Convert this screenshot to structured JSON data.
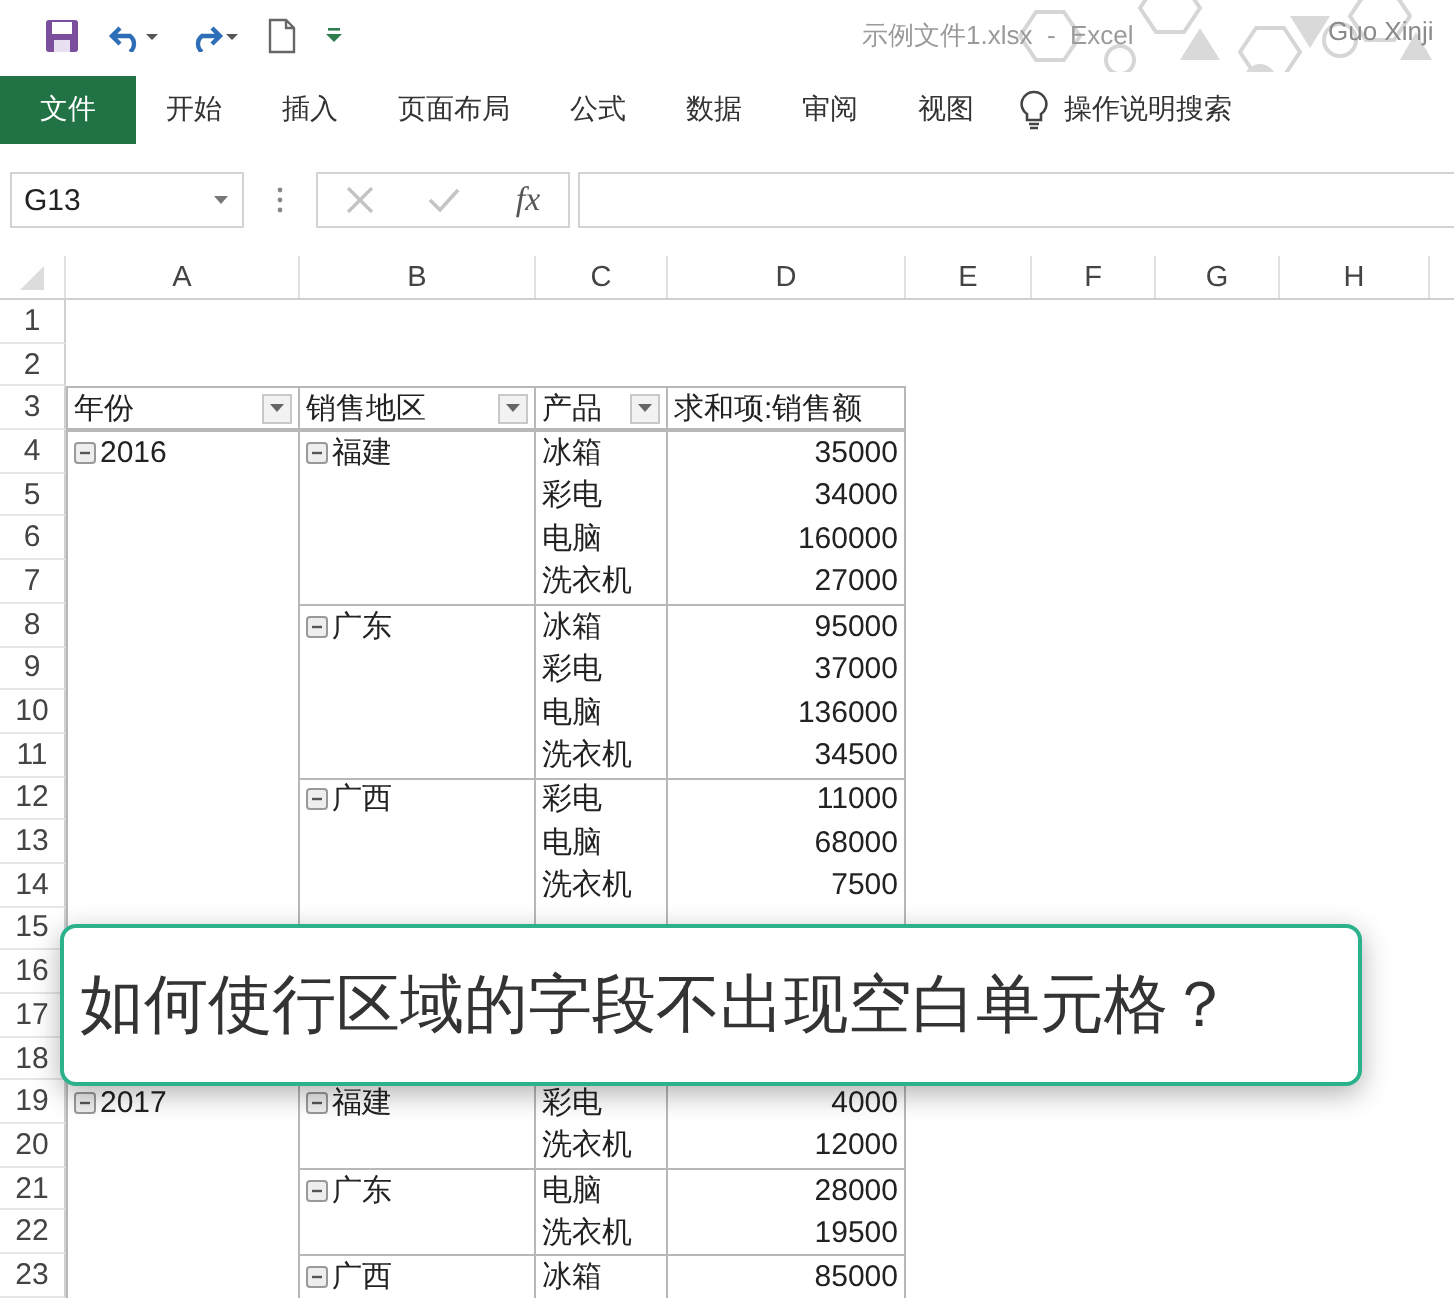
{
  "title_bar": {
    "file_title": "示例文件1.xlsx  -  Excel",
    "user": "Guo Xinji"
  },
  "ribbon": {
    "tabs": [
      {
        "label": "文件",
        "selected": true
      },
      {
        "label": "开始",
        "selected": false
      },
      {
        "label": "插入",
        "selected": false
      },
      {
        "label": "页面布局",
        "selected": false
      },
      {
        "label": "公式",
        "selected": false
      },
      {
        "label": "数据",
        "selected": false
      },
      {
        "label": "审阅",
        "selected": false
      },
      {
        "label": "视图",
        "selected": false
      }
    ],
    "tell_me": "操作说明搜索"
  },
  "formula_bar": {
    "name_box": "G13",
    "fx": "fx"
  },
  "sheet": {
    "columns": [
      "A",
      "B",
      "C",
      "D",
      "E",
      "F",
      "G",
      "H"
    ],
    "headers": [
      "年份",
      "销售地区",
      "产品",
      "求和项:销售额"
    ],
    "rows": [
      {
        "number": "1",
        "kind": "blank"
      },
      {
        "number": "2",
        "kind": "blank"
      },
      {
        "number": "3",
        "kind": "header"
      },
      {
        "number": "4",
        "kind": "data",
        "year": "2016",
        "region": "福建",
        "product": "冰箱",
        "amount": "35000"
      },
      {
        "number": "5",
        "kind": "data",
        "product": "彩电",
        "amount": "34000"
      },
      {
        "number": "6",
        "kind": "data",
        "product": "电脑",
        "amount": "160000"
      },
      {
        "number": "7",
        "kind": "data",
        "product": "洗衣机",
        "amount": "27000"
      },
      {
        "number": "8",
        "kind": "data",
        "region": "广东",
        "product": "冰箱",
        "amount": "95000"
      },
      {
        "number": "9",
        "kind": "data",
        "product": "彩电",
        "amount": "37000"
      },
      {
        "number": "10",
        "kind": "data",
        "product": "电脑",
        "amount": "136000"
      },
      {
        "number": "11",
        "kind": "data",
        "product": "洗衣机",
        "amount": "34500"
      },
      {
        "number": "12",
        "kind": "data",
        "region": "广西",
        "product": "彩电",
        "amount": "11000"
      },
      {
        "number": "13",
        "kind": "data",
        "product": "电脑",
        "amount": "68000"
      },
      {
        "number": "14",
        "kind": "data",
        "product": "洗衣机",
        "amount": "7500"
      },
      {
        "number": "15",
        "kind": "covered"
      },
      {
        "number": "16",
        "kind": "covered"
      },
      {
        "number": "17",
        "kind": "covered"
      },
      {
        "number": "18",
        "kind": "covered"
      },
      {
        "number": "19",
        "kind": "data",
        "year": "2017",
        "region": "福建",
        "product": "彩电",
        "amount": "4000"
      },
      {
        "number": "20",
        "kind": "data",
        "product": "洗衣机",
        "amount": "12000"
      },
      {
        "number": "21",
        "kind": "data",
        "region": "广东",
        "product": "电脑",
        "amount": "28000"
      },
      {
        "number": "22",
        "kind": "data",
        "product": "洗衣机",
        "amount": "19500"
      },
      {
        "number": "23",
        "kind": "data",
        "region": "广西",
        "product": "冰箱",
        "amount": "85000"
      }
    ]
  },
  "caption": {
    "text": "如何使行区域的字段不出现空白单元格？"
  }
}
